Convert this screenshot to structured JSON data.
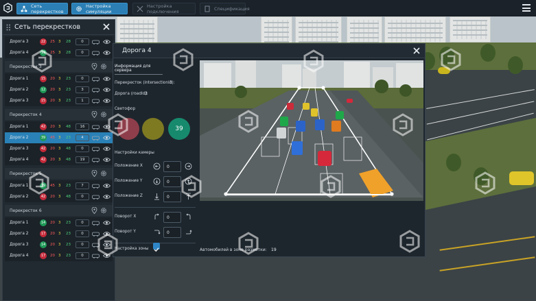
{
  "toolbar": {
    "btn_network": "Сеть перекрестков",
    "btn_sim": "Настройка симуляции",
    "btn_connection": "Настройка подключения",
    "btn_spec": "Спецификация"
  },
  "sidebar": {
    "title": "Сеть перекрестков",
    "top_rows": [
      {
        "road": "Дорога 3",
        "badge": "22",
        "light": "red",
        "n1": "25",
        "n2": "3",
        "n3": "28",
        "count": "0"
      },
      {
        "road": "Дорога 4",
        "badge": "19",
        "light": "green",
        "n1": "25",
        "n2": "3",
        "n3": "28",
        "count": "0"
      }
    ],
    "groups": [
      {
        "title": "Перекресток 3",
        "rows": [
          {
            "road": "Дорога 1",
            "badge": "15",
            "light": "red",
            "n1": "20",
            "n2": "3",
            "n3": "23",
            "count": "0"
          },
          {
            "road": "Дорога 2",
            "badge": "12",
            "light": "green",
            "n1": "20",
            "n2": "3",
            "n3": "23",
            "count": "3"
          },
          {
            "road": "Дорога 3",
            "badge": "15",
            "light": "red",
            "n1": "20",
            "n2": "3",
            "n3": "23",
            "count": "1"
          }
        ]
      },
      {
        "title": "Перекресток 4",
        "rows": [
          {
            "road": "Дорога 1",
            "badge": "42",
            "light": "red",
            "n1": "20",
            "n2": "3",
            "n3": "48",
            "count": "16"
          },
          {
            "road": "Дорога 2",
            "badge": "39",
            "light": "green",
            "n1": "45",
            "n2": "3",
            "n3": "23",
            "count": "4",
            "active": true
          },
          {
            "road": "Дорога 3",
            "badge": "42",
            "light": "red",
            "n1": "20",
            "n2": "3",
            "n3": "48",
            "count": "0"
          },
          {
            "road": "Дорога 4",
            "badge": "42",
            "light": "red",
            "n1": "20",
            "n2": "3",
            "n3": "48",
            "count": "19"
          }
        ]
      },
      {
        "title": "Перекресток 5",
        "rows": [
          {
            "road": "Дорога 1",
            "badge": "39",
            "light": "green",
            "n1": "45",
            "n2": "3",
            "n3": "23",
            "count": "7"
          },
          {
            "road": "Дорога 2",
            "badge": "42",
            "light": "red",
            "n1": "20",
            "n2": "3",
            "n3": "48",
            "count": "0"
          }
        ]
      },
      {
        "title": "Перекресток 6",
        "rows": [
          {
            "road": "Дорога 1",
            "badge": "14",
            "light": "green",
            "n1": "20",
            "n2": "3",
            "n3": "23",
            "count": "0"
          },
          {
            "road": "Дорога 2",
            "badge": "17",
            "light": "red",
            "n1": "20",
            "n2": "3",
            "n3": "23",
            "count": "0"
          },
          {
            "road": "Дорога 3",
            "badge": "14",
            "light": "green",
            "n1": "20",
            "n2": "3",
            "n3": "23",
            "count": "0"
          },
          {
            "road": "Дорога 4",
            "badge": "17",
            "light": "red",
            "n1": "20",
            "n2": "3",
            "n3": "23",
            "count": "0"
          }
        ]
      }
    ]
  },
  "modal": {
    "title": "Дорога 4",
    "info_header": "Информация для сервера",
    "intersection_label": "Перекресток (intersectionId):",
    "intersection_value": "3",
    "road_label": "Дорога (roadId):",
    "road_value": "3",
    "light_label": "Светофор",
    "light_value": "39",
    "camera_label": "Настройки камеры",
    "pos_x_label": "Положение X",
    "pos_x_value": "0",
    "pos_y_label": "Положение Y",
    "pos_y_value": "0",
    "pos_z_label": "Положение Z",
    "pos_z_value": "0",
    "rot_x_label": "Поворот X",
    "rot_x_value": "0",
    "rot_y_label": "Поворот Y",
    "rot_y_value": "0",
    "zone_label": "Настройка зоны",
    "cars_in_zone_label": "Автомобилей в зоне разметки:",
    "cars_in_zone_value": "19"
  },
  "colors": {
    "accent": "#2b7fb5",
    "red_light": "#c52a3a",
    "green_light": "#1f9a58",
    "yellow_value": "#e8cf3b",
    "panel_bg": "#222a31"
  },
  "icons": {
    "logo": "app-logo-icon",
    "network": "network-icon",
    "sim": "gear-icon",
    "connection": "connection-icon",
    "spec": "document-icon",
    "menu": "hamburger-icon"
  }
}
